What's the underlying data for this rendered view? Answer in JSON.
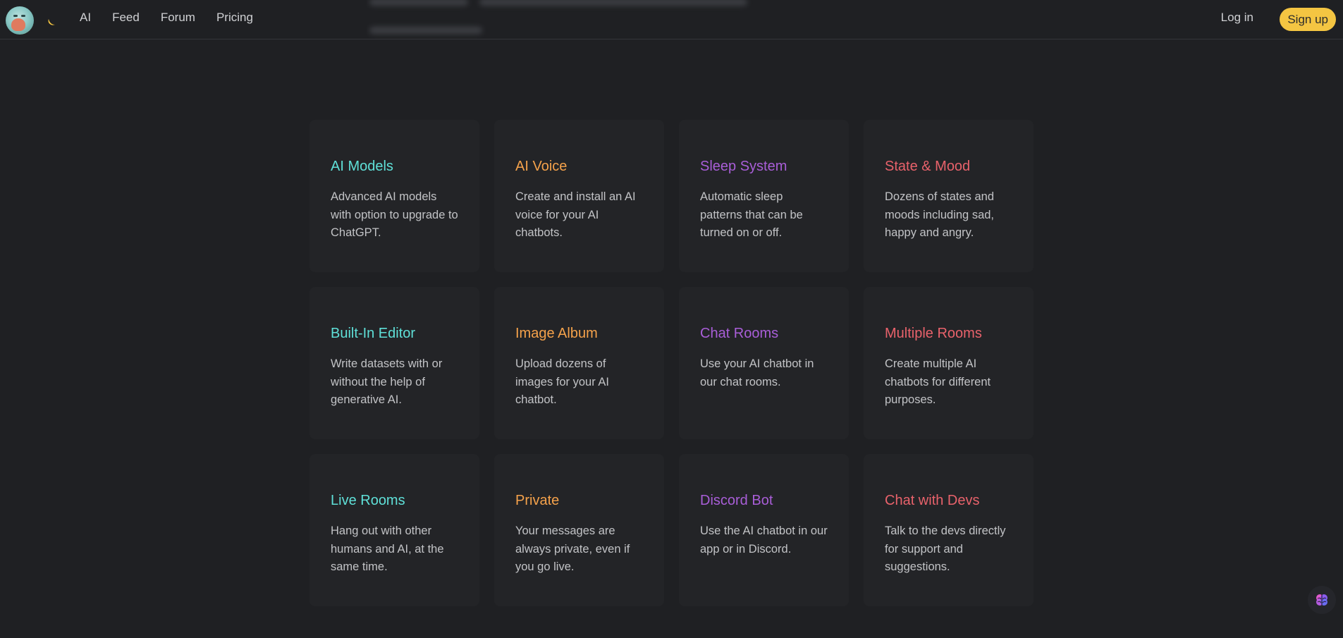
{
  "header": {
    "logo_icon": "avatar-logo-icon",
    "theme_icon": "moon-icon",
    "nav": [
      {
        "label": "AI"
      },
      {
        "label": "Feed"
      },
      {
        "label": "Forum"
      },
      {
        "label": "Pricing"
      }
    ],
    "login_label": "Log in",
    "signup_label": "Sign up"
  },
  "features": [
    {
      "title": "AI Models",
      "desc": "Advanced AI models with option to upgrade to ChatGPT.",
      "color": "#5fe0d8"
    },
    {
      "title": "AI Voice",
      "desc": "Create and install an AI voice for your AI chatbots.",
      "color": "#f5a24b"
    },
    {
      "title": "Sleep System",
      "desc": "Automatic sleep patterns that can be turned on or off.",
      "color": "#a95ed8"
    },
    {
      "title": "State & Mood",
      "desc": "Dozens of states and moods including sad, happy and angry.",
      "color": "#e8626b"
    },
    {
      "title": "Built-In Editor",
      "desc": "Write datasets with or without the help of generative AI.",
      "color": "#5fe0d8"
    },
    {
      "title": "Image Album",
      "desc": "Upload dozens of images for your AI chatbot.",
      "color": "#f5a24b"
    },
    {
      "title": "Chat Rooms",
      "desc": "Use your AI chatbot in our chat rooms.",
      "color": "#a95ed8"
    },
    {
      "title": "Multiple Rooms",
      "desc": "Create multiple AI chatbots for different purposes.",
      "color": "#e8626b"
    },
    {
      "title": "Live Rooms",
      "desc": "Hang out with other humans and AI, at the same time.",
      "color": "#5fe0d8"
    },
    {
      "title": "Private",
      "desc": "Your messages are always private, even if you go live.",
      "color": "#f5a24b"
    },
    {
      "title": "Discord Bot",
      "desc": "Use the AI chatbot in our app or in Discord.",
      "color": "#a95ed8"
    },
    {
      "title": "Chat with Devs",
      "desc": "Talk to the devs directly for support and suggestions.",
      "color": "#e8626b"
    }
  ],
  "floating_button_icon": "brain-icon"
}
